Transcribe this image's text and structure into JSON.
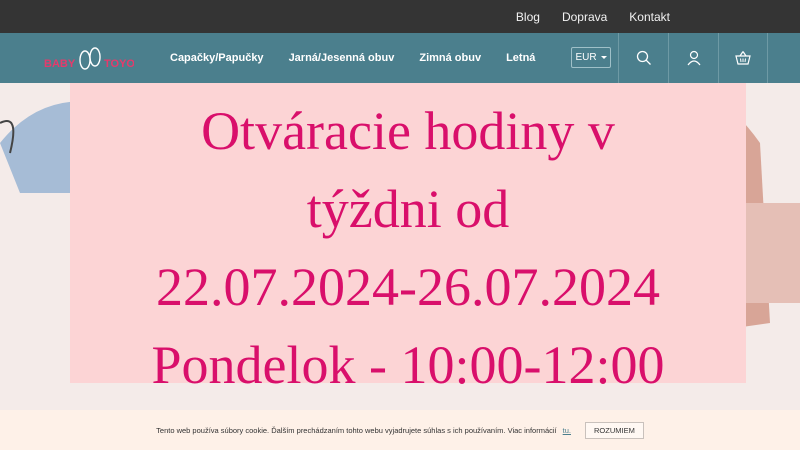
{
  "top_links": [
    "Blog",
    "Doprava",
    "Kontakt"
  ],
  "logo_text": "BABY TOYO",
  "menu": [
    "Capačky/Papučky",
    "Jarná/Jesenná obuv",
    "Zimná obuv",
    "Letná"
  ],
  "currency": "EUR",
  "icons": {
    "search": "search-icon",
    "account": "user-icon",
    "cart": "basket-icon"
  },
  "hero": {
    "lines": [
      "Otváracie hodiny v",
      "týždni od",
      "22.07.2024-26.07.2024",
      "Pondelok - 10:00-12:00"
    ]
  },
  "cookie": {
    "text": "Tento web používa súbory cookie. Ďalším prechádzaním tohto webu vyjadrujete súhlas s ich používaním. Viac informácií",
    "link": "tu.",
    "button": "ROZUMIEM"
  },
  "colors": {
    "navbar": "#4b7f8d",
    "topbar": "#343434",
    "headline": "#d90f6b",
    "panel": "#fcd4d5"
  }
}
